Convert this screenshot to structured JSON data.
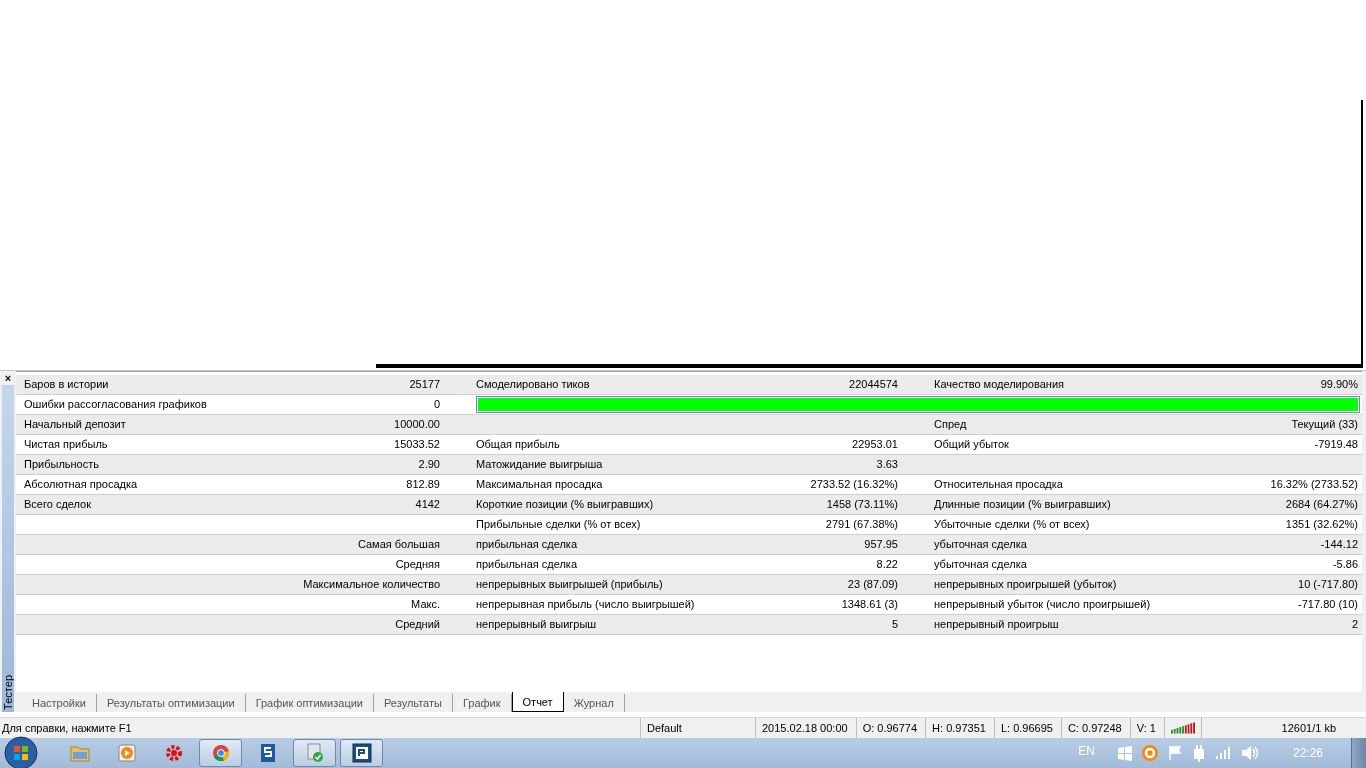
{
  "panel": {
    "close": "×",
    "title": "Тестер"
  },
  "report": {
    "rows": [
      {
        "cells": [
          {
            "kind": "pair",
            "label": "Баров в истории",
            "value": "25177"
          },
          {
            "kind": "pair",
            "label": "Смоделировано тиков",
            "value": "22044574"
          },
          {
            "kind": "pair",
            "label": "Качество моделирования",
            "value": "99.90%"
          }
        ]
      },
      {
        "cells": [
          {
            "kind": "pair",
            "label": "Ошибки рассогласования графиков",
            "value": "0"
          },
          {
            "kind": "bar",
            "level": 1
          }
        ]
      },
      {
        "cells": [
          {
            "kind": "pair",
            "label": "Начальный депозит",
            "value": "10000.00"
          },
          {
            "kind": "empty"
          },
          {
            "kind": "pair",
            "label": "Спред",
            "value": "Текущий (33)"
          }
        ]
      },
      {
        "cells": [
          {
            "kind": "pair",
            "label": "Чистая прибыль",
            "value": "15033.52"
          },
          {
            "kind": "pair",
            "label": "Общая прибыль",
            "value": "22953.01"
          },
          {
            "kind": "pair",
            "label": "Общий убыток",
            "value": "-7919.48"
          }
        ]
      },
      {
        "cells": [
          {
            "kind": "pair",
            "label": "Прибыльность",
            "value": "2.90"
          },
          {
            "kind": "pair",
            "label": "Матожидание выигрыша",
            "value": "3.63"
          },
          {
            "kind": "empty"
          }
        ]
      },
      {
        "cells": [
          {
            "kind": "pair",
            "label": "Абсолютная просадка",
            "value": "812.89"
          },
          {
            "kind": "pair",
            "label": "Максимальная просадка",
            "value": "2733.52 (16.32%)"
          },
          {
            "kind": "pair",
            "label": "Относительная просадка",
            "value": "16.32% (2733.52)"
          }
        ]
      },
      {
        "cells": [
          {
            "kind": "pair",
            "label": "Всего сделок",
            "value": "4142"
          },
          {
            "kind": "pair",
            "label": "Короткие позиции (% выигравших)",
            "value": "1458 (73.11%)"
          },
          {
            "kind": "pair",
            "label": "Длинные позиции (% выигравших)",
            "value": "2684 (64.27%)"
          }
        ]
      },
      {
        "cells": [
          {
            "kind": "empty"
          },
          {
            "kind": "pair",
            "label": "Прибыльные сделки (% от всех)",
            "value": "2791 (67.38%)"
          },
          {
            "kind": "pair",
            "label": "Убыточные сделки (% от всех)",
            "value": "1351 (32.62%)"
          }
        ]
      },
      {
        "cells": [
          {
            "kind": "heading",
            "label": "Самая большая"
          },
          {
            "kind": "pair",
            "label": "прибыльная сделка",
            "value": "957.95"
          },
          {
            "kind": "pair",
            "label": "убыточная сделка",
            "value": "-144.12"
          }
        ]
      },
      {
        "cells": [
          {
            "kind": "heading",
            "label": "Средняя"
          },
          {
            "kind": "pair",
            "label": "прибыльная сделка",
            "value": "8.22"
          },
          {
            "kind": "pair",
            "label": "убыточная сделка",
            "value": "-5.86"
          }
        ]
      },
      {
        "cells": [
          {
            "kind": "heading",
            "label": "Максимальное количество"
          },
          {
            "kind": "pair",
            "label": "непрерывных выигрышей (прибыль)",
            "value": "23 (87.09)"
          },
          {
            "kind": "pair",
            "label": "непрерывных проигрышей (убыток)",
            "value": "10 (-717.80)"
          }
        ]
      },
      {
        "cells": [
          {
            "kind": "heading",
            "label": "Макс."
          },
          {
            "kind": "pair",
            "label": "непрерывная прибыль (число выигрышей)",
            "value": "1348.61 (3)"
          },
          {
            "kind": "pair",
            "label": "непрерывный убыток (число проигрышей)",
            "value": "-717.80 (10)"
          }
        ]
      },
      {
        "cells": [
          {
            "kind": "heading",
            "label": "Средний"
          },
          {
            "kind": "pair",
            "label": "непрерывный выигрыш",
            "value": "5"
          },
          {
            "kind": "pair",
            "label": "непрерывный проигрыш",
            "value": "2"
          }
        ]
      }
    ]
  },
  "tabs": [
    {
      "label": "Настройки",
      "selected": false
    },
    {
      "label": "Результаты оптимизации",
      "selected": false
    },
    {
      "label": "График оптимизации",
      "selected": false
    },
    {
      "label": "Результаты",
      "selected": false
    },
    {
      "label": "График",
      "selected": false
    },
    {
      "label": "Отчет",
      "selected": true
    },
    {
      "label": "Журнал",
      "selected": false
    }
  ],
  "status_bar": {
    "help": "Для справки, нажмите F1",
    "profile": "Default",
    "fields": [
      "2015.02.18 00:00",
      "O: 0.96774",
      "H: 0.97351",
      "L: 0.96695",
      "C: 0.97248",
      "V: 1"
    ],
    "traffic": "12601/1 kb"
  },
  "taskbar": {
    "apps": [
      {
        "kind": "folder",
        "open": false
      },
      {
        "kind": "player",
        "open": false
      },
      {
        "kind": "gear",
        "open": false
      },
      {
        "kind": "browser",
        "open": true
      },
      {
        "kind": "document",
        "open": false
      },
      {
        "kind": "shield",
        "open": true
      },
      {
        "kind": "terminal",
        "open": true
      }
    ],
    "language": "EN",
    "time": "22:26"
  }
}
